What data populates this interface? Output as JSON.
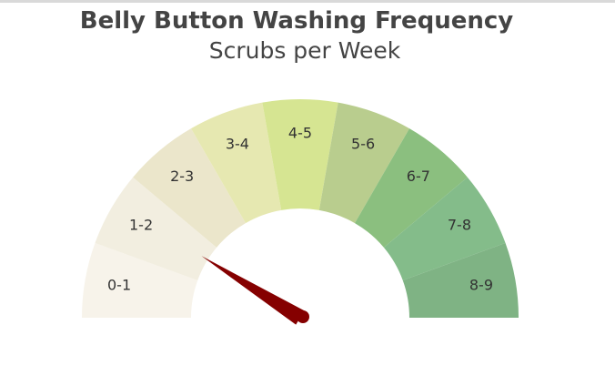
{
  "chart_data": {
    "type": "gauge",
    "title": "Belly Button Washing Frequency",
    "subtitle": "Scrubs per Week",
    "range": [
      0,
      9
    ],
    "value": 1.6,
    "segments": [
      {
        "label": "0-1",
        "color": "#f7f3ea"
      },
      {
        "label": "1-2",
        "color": "#f2eee0"
      },
      {
        "label": "2-3",
        "color": "#ebe6cb"
      },
      {
        "label": "3-4",
        "color": "#e6e8b1"
      },
      {
        "label": "4-5",
        "color": "#d6e592"
      },
      {
        "label": "5-6",
        "color": "#b9cd8e"
      },
      {
        "label": "6-7",
        "color": "#8bbf7f"
      },
      {
        "label": "7-8",
        "color": "#84bc8a"
      },
      {
        "label": "8-9",
        "color": "#7fb384"
      }
    ],
    "needle_color": "#850000"
  }
}
